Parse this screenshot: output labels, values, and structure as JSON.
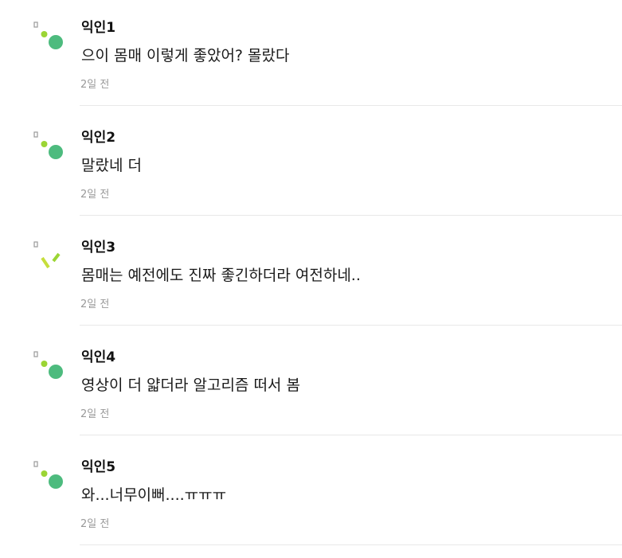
{
  "comments": [
    {
      "author": "익인1",
      "text": "으이 몸매 이렇게 좋았어? 몰랐다",
      "time": "2일 전",
      "avatar_icon": "dots-avatar-icon"
    },
    {
      "author": "익인2",
      "text": "말랐네 더",
      "time": "2일 전",
      "avatar_icon": "dots-avatar-icon"
    },
    {
      "author": "익인3",
      "text": "몸매는 예전에도 진짜 좋긴하더라 여전하네..",
      "time": "2일 전",
      "avatar_icon": "dashes-avatar-icon"
    },
    {
      "author": "익인4",
      "text": "영상이 더 얇더라 알고리즘 떠서 봄",
      "time": "2일 전",
      "avatar_icon": "dots-avatar-icon"
    },
    {
      "author": "익인5",
      "text": "와...너무이뻐....ㅠㅠㅠ",
      "time": "2일 전",
      "avatar_icon": "dots-avatar-icon"
    }
  ],
  "colors": {
    "avatar_green": "#4dbb7e",
    "avatar_lime": "#9bd534",
    "avatar_gray": "#9a9a9a"
  }
}
